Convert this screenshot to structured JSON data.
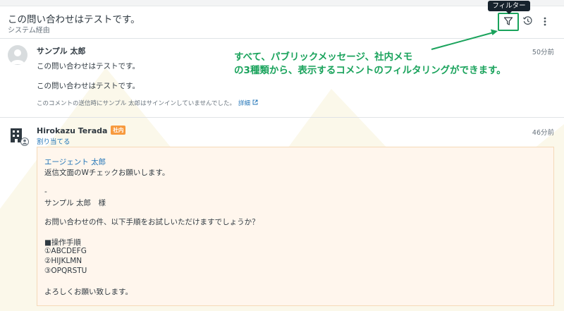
{
  "header": {
    "title": "この問い合わせはテストです。",
    "subtitle": "システム経由",
    "tooltip": "フィルター",
    "icons": [
      "filter-icon",
      "history-icon",
      "more-vertical-icon"
    ]
  },
  "annotation": {
    "line1": "すべて、パブリックメッセージ、社内メモ",
    "line2": "の3種類から、表示するコメントのフィルタリングができます。",
    "color": "#1aa35c"
  },
  "comments": [
    {
      "author": "サンプル 太郎",
      "time": "50分前",
      "body": [
        "この問い合わせはテストです。",
        "この問い合わせはテストです。"
      ],
      "notice": "このコメントの送信時にサンプル 太郎はサインインしていませんでした。",
      "notice_link": "詳細"
    },
    {
      "author": "Hirokazu Terada",
      "badge": "社内",
      "assign": "割り当てる",
      "time": "46分前",
      "mention": "エージェント 太郎",
      "lines": [
        "返信文面のWチェックお願いします。",
        "-",
        "サンプル 太郎　様",
        "お問い合わせの件、以下手順をお試しいただけますでしょうか？",
        "■操作手順",
        "①ABCDEFG",
        "②HIJKLMN",
        "③OPQRSTU",
        "よろしくお願い致します。"
      ]
    }
  ],
  "colors": {
    "link": "#1f73b7",
    "internal_bg": "#fff6ed",
    "badge": "#f79a3e"
  }
}
